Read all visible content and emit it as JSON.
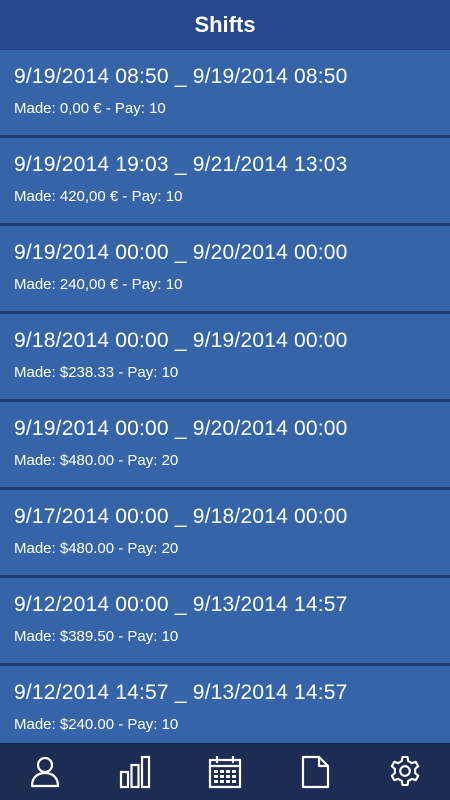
{
  "header": {
    "title": "Shifts"
  },
  "shifts": [
    {
      "range": "9/19/2014 08:50 _ 9/19/2014 08:50",
      "meta": "Made: 0,00 € - Pay: 10"
    },
    {
      "range": "9/19/2014 19:03 _ 9/21/2014 13:03",
      "meta": "Made: 420,00 € - Pay: 10"
    },
    {
      "range": "9/19/2014 00:00 _ 9/20/2014 00:00",
      "meta": "Made: 240,00 € - Pay: 10"
    },
    {
      "range": "9/18/2014 00:00 _ 9/19/2014 00:00",
      "meta": "Made: $238.33 - Pay: 10"
    },
    {
      "range": "9/19/2014 00:00 _ 9/20/2014 00:00",
      "meta": "Made: $480.00 - Pay: 20"
    },
    {
      "range": "9/17/2014 00:00 _ 9/18/2014 00:00",
      "meta": "Made: $480.00 - Pay: 20"
    },
    {
      "range": "9/12/2014 00:00 _ 9/13/2014 14:57",
      "meta": "Made: $389.50 - Pay: 10"
    },
    {
      "range": "9/12/2014 14:57 _ 9/13/2014 14:57",
      "meta": "Made: $240.00 - Pay: 10"
    }
  ],
  "tabbar": {
    "items": [
      {
        "icon": "user-icon"
      },
      {
        "icon": "bar-chart-icon"
      },
      {
        "icon": "calendar-icon"
      },
      {
        "icon": "document-icon"
      },
      {
        "icon": "gear-icon"
      }
    ]
  },
  "colors": {
    "header_bg": "#26478c",
    "item_bg": "#3565a8",
    "tabbar_bg": "#1c2c52",
    "text": "#ffffff"
  }
}
